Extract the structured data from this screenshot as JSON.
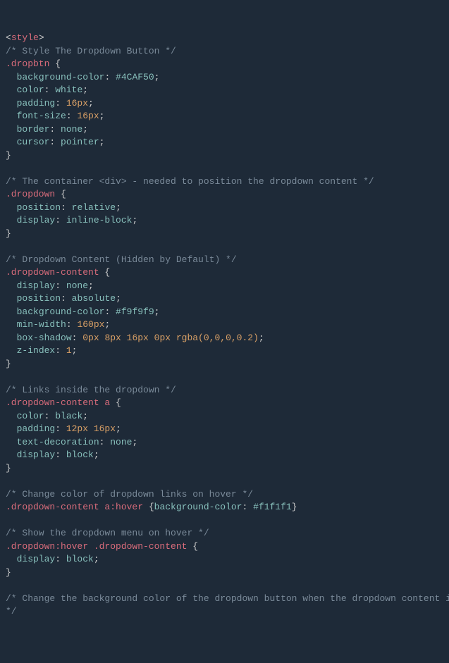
{
  "lines": [
    {
      "parts": [
        {
          "t": "<",
          "c": "punct"
        },
        {
          "t": "style",
          "c": "tag"
        },
        {
          "t": ">",
          "c": "punct"
        }
      ]
    },
    {
      "parts": [
        {
          "t": "/* Style The Dropdown Button */",
          "c": "comment"
        }
      ]
    },
    {
      "parts": [
        {
          "t": ".dropbtn",
          "c": "selector"
        },
        {
          "t": " {",
          "c": "brace"
        }
      ]
    },
    {
      "parts": [
        {
          "t": "  ",
          "c": "punct"
        },
        {
          "t": "background-color",
          "c": "prop"
        },
        {
          "t": ": ",
          "c": "punct"
        },
        {
          "t": "#4CAF50",
          "c": "hex"
        },
        {
          "t": ";",
          "c": "punct"
        }
      ]
    },
    {
      "parts": [
        {
          "t": "  ",
          "c": "punct"
        },
        {
          "t": "color",
          "c": "prop"
        },
        {
          "t": ": ",
          "c": "punct"
        },
        {
          "t": "white",
          "c": "kw-val"
        },
        {
          "t": ";",
          "c": "punct"
        }
      ]
    },
    {
      "parts": [
        {
          "t": "  ",
          "c": "punct"
        },
        {
          "t": "padding",
          "c": "prop"
        },
        {
          "t": ": ",
          "c": "punct"
        },
        {
          "t": "16px",
          "c": "num"
        },
        {
          "t": ";",
          "c": "punct"
        }
      ]
    },
    {
      "parts": [
        {
          "t": "  ",
          "c": "punct"
        },
        {
          "t": "font-size",
          "c": "prop"
        },
        {
          "t": ": ",
          "c": "punct"
        },
        {
          "t": "16px",
          "c": "num"
        },
        {
          "t": ";",
          "c": "punct"
        }
      ]
    },
    {
      "parts": [
        {
          "t": "  ",
          "c": "punct"
        },
        {
          "t": "border",
          "c": "prop"
        },
        {
          "t": ": ",
          "c": "punct"
        },
        {
          "t": "none",
          "c": "kw-val"
        },
        {
          "t": ";",
          "c": "punct"
        }
      ]
    },
    {
      "parts": [
        {
          "t": "  ",
          "c": "punct"
        },
        {
          "t": "cursor",
          "c": "prop"
        },
        {
          "t": ": ",
          "c": "punct"
        },
        {
          "t": "pointer",
          "c": "kw-val"
        },
        {
          "t": ";",
          "c": "punct"
        }
      ]
    },
    {
      "parts": [
        {
          "t": "}",
          "c": "brace"
        }
      ]
    },
    {
      "parts": [
        {
          "t": "",
          "c": "punct"
        }
      ]
    },
    {
      "parts": [
        {
          "t": "/* The container <div> - needed to position the dropdown content */",
          "c": "comment"
        }
      ]
    },
    {
      "parts": [
        {
          "t": ".dropdown",
          "c": "selector"
        },
        {
          "t": " {",
          "c": "brace"
        }
      ]
    },
    {
      "parts": [
        {
          "t": "  ",
          "c": "punct"
        },
        {
          "t": "position",
          "c": "prop"
        },
        {
          "t": ": ",
          "c": "punct"
        },
        {
          "t": "relative",
          "c": "kw-val"
        },
        {
          "t": ";",
          "c": "punct"
        }
      ]
    },
    {
      "parts": [
        {
          "t": "  ",
          "c": "punct"
        },
        {
          "t": "display",
          "c": "prop"
        },
        {
          "t": ": ",
          "c": "punct"
        },
        {
          "t": "inline-block",
          "c": "kw-val"
        },
        {
          "t": ";",
          "c": "punct"
        }
      ]
    },
    {
      "parts": [
        {
          "t": "}",
          "c": "brace"
        }
      ]
    },
    {
      "parts": [
        {
          "t": "",
          "c": "punct"
        }
      ]
    },
    {
      "parts": [
        {
          "t": "/* Dropdown Content (Hidden by Default) */",
          "c": "comment"
        }
      ]
    },
    {
      "parts": [
        {
          "t": ".dropdown-content",
          "c": "selector"
        },
        {
          "t": " {",
          "c": "brace"
        }
      ]
    },
    {
      "parts": [
        {
          "t": "  ",
          "c": "punct"
        },
        {
          "t": "display",
          "c": "prop"
        },
        {
          "t": ": ",
          "c": "punct"
        },
        {
          "t": "none",
          "c": "kw-val"
        },
        {
          "t": ";",
          "c": "punct"
        }
      ]
    },
    {
      "parts": [
        {
          "t": "  ",
          "c": "punct"
        },
        {
          "t": "position",
          "c": "prop"
        },
        {
          "t": ": ",
          "c": "punct"
        },
        {
          "t": "absolute",
          "c": "kw-val"
        },
        {
          "t": ";",
          "c": "punct"
        }
      ]
    },
    {
      "parts": [
        {
          "t": "  ",
          "c": "punct"
        },
        {
          "t": "background-color",
          "c": "prop"
        },
        {
          "t": ": ",
          "c": "punct"
        },
        {
          "t": "#f9f9f9",
          "c": "hex"
        },
        {
          "t": ";",
          "c": "punct"
        }
      ]
    },
    {
      "parts": [
        {
          "t": "  ",
          "c": "punct"
        },
        {
          "t": "min-width",
          "c": "prop"
        },
        {
          "t": ": ",
          "c": "punct"
        },
        {
          "t": "160px",
          "c": "num"
        },
        {
          "t": ";",
          "c": "punct"
        }
      ]
    },
    {
      "parts": [
        {
          "t": "  ",
          "c": "punct"
        },
        {
          "t": "box-shadow",
          "c": "prop"
        },
        {
          "t": ": ",
          "c": "punct"
        },
        {
          "t": "0px 8px 16px 0px rgba(0,0,0,0.2)",
          "c": "num"
        },
        {
          "t": ";",
          "c": "punct"
        }
      ]
    },
    {
      "parts": [
        {
          "t": "  ",
          "c": "punct"
        },
        {
          "t": "z-index",
          "c": "prop"
        },
        {
          "t": ": ",
          "c": "punct"
        },
        {
          "t": "1",
          "c": "num"
        },
        {
          "t": ";",
          "c": "punct"
        }
      ]
    },
    {
      "parts": [
        {
          "t": "}",
          "c": "brace"
        }
      ]
    },
    {
      "parts": [
        {
          "t": "",
          "c": "punct"
        }
      ]
    },
    {
      "parts": [
        {
          "t": "/* Links inside the dropdown */",
          "c": "comment"
        }
      ]
    },
    {
      "parts": [
        {
          "t": ".dropdown-content a",
          "c": "selector"
        },
        {
          "t": " {",
          "c": "brace"
        }
      ]
    },
    {
      "parts": [
        {
          "t": "  ",
          "c": "punct"
        },
        {
          "t": "color",
          "c": "prop"
        },
        {
          "t": ": ",
          "c": "punct"
        },
        {
          "t": "black",
          "c": "kw-val"
        },
        {
          "t": ";",
          "c": "punct"
        }
      ]
    },
    {
      "parts": [
        {
          "t": "  ",
          "c": "punct"
        },
        {
          "t": "padding",
          "c": "prop"
        },
        {
          "t": ": ",
          "c": "punct"
        },
        {
          "t": "12px 16px",
          "c": "num"
        },
        {
          "t": ";",
          "c": "punct"
        }
      ]
    },
    {
      "parts": [
        {
          "t": "  ",
          "c": "punct"
        },
        {
          "t": "text-decoration",
          "c": "prop"
        },
        {
          "t": ": ",
          "c": "punct"
        },
        {
          "t": "none",
          "c": "kw-val"
        },
        {
          "t": ";",
          "c": "punct"
        }
      ]
    },
    {
      "parts": [
        {
          "t": "  ",
          "c": "punct"
        },
        {
          "t": "display",
          "c": "prop"
        },
        {
          "t": ": ",
          "c": "punct"
        },
        {
          "t": "block",
          "c": "kw-val"
        },
        {
          "t": ";",
          "c": "punct"
        }
      ]
    },
    {
      "parts": [
        {
          "t": "}",
          "c": "brace"
        }
      ]
    },
    {
      "parts": [
        {
          "t": "",
          "c": "punct"
        }
      ]
    },
    {
      "parts": [
        {
          "t": "/* Change color of dropdown links on hover */",
          "c": "comment"
        }
      ]
    },
    {
      "parts": [
        {
          "t": ".dropdown-content a:hover",
          "c": "selector"
        },
        {
          "t": " {",
          "c": "brace"
        },
        {
          "t": "background-color",
          "c": "prop"
        },
        {
          "t": ": ",
          "c": "punct"
        },
        {
          "t": "#f1f1f1",
          "c": "hex"
        },
        {
          "t": "}",
          "c": "brace"
        }
      ]
    },
    {
      "parts": [
        {
          "t": "",
          "c": "punct"
        }
      ]
    },
    {
      "parts": [
        {
          "t": "/* Show the dropdown menu on hover */",
          "c": "comment"
        }
      ]
    },
    {
      "parts": [
        {
          "t": ".dropdown:hover .dropdown-content",
          "c": "selector"
        },
        {
          "t": " {",
          "c": "brace"
        }
      ]
    },
    {
      "parts": [
        {
          "t": "  ",
          "c": "punct"
        },
        {
          "t": "display",
          "c": "prop"
        },
        {
          "t": ": ",
          "c": "punct"
        },
        {
          "t": "block",
          "c": "kw-val"
        },
        {
          "t": ";",
          "c": "punct"
        }
      ]
    },
    {
      "parts": [
        {
          "t": "}",
          "c": "brace"
        }
      ]
    },
    {
      "parts": [
        {
          "t": "",
          "c": "punct"
        }
      ]
    },
    {
      "parts": [
        {
          "t": "/* Change the background color of the dropdown button when the dropdown content is shown",
          "c": "comment"
        }
      ]
    },
    {
      "parts": [
        {
          "t": "*/",
          "c": "comment"
        }
      ]
    }
  ]
}
